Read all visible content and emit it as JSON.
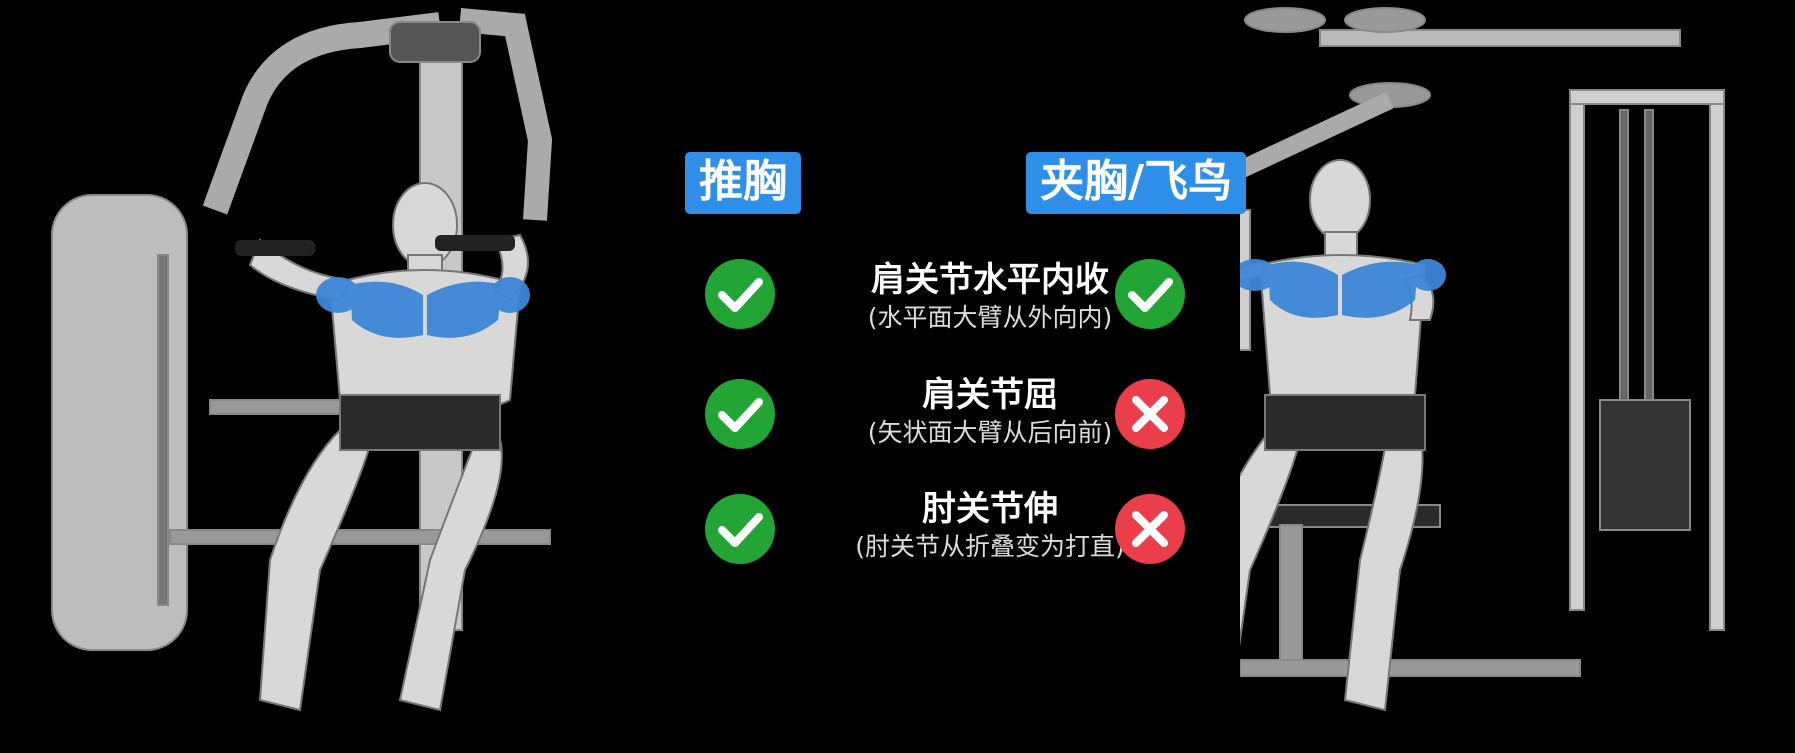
{
  "labels": {
    "left": "推胸",
    "right": "夹胸/飞鸟"
  },
  "rows": [
    {
      "title": "肩关节水平内收",
      "subtitle": "(水平面大臂从外向内)",
      "left": "check",
      "right": "check"
    },
    {
      "title": "肩关节屈",
      "subtitle": "(矢状面大臂从后向前)",
      "left": "check",
      "right": "cross"
    },
    {
      "title": "肘关节伸",
      "subtitle": "(肘关节从折叠变为打直)",
      "left": "check",
      "right": "cross"
    }
  ],
  "colors": {
    "label_bg": "#2f8fe8",
    "check": "#23a536",
    "cross": "#ea3f4a",
    "muscle": "#3d86d6"
  }
}
